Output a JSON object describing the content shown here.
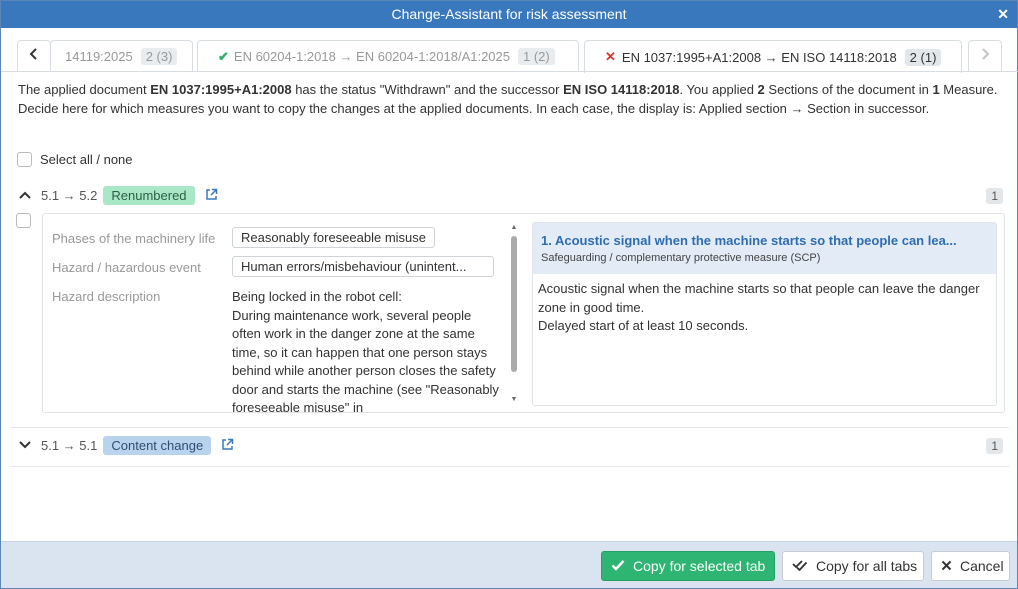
{
  "window": {
    "title": "Change-Assistant for risk assessment",
    "close_glyph": "✕"
  },
  "tabs": {
    "prev_glyph": "‹",
    "next_glyph": "›",
    "items": [
      {
        "label": "14119:2025",
        "count": "2 (3)",
        "status": ""
      },
      {
        "label": "EN 60204-1:2018 → EN 60204-1:2018/A1:2025",
        "count": "1 (2)",
        "status": "ok"
      },
      {
        "label": "EN 1037:1995+A1:2008 → EN ISO 14118:2018",
        "count": "2 (1)",
        "status": "error",
        "active": true
      }
    ],
    "ok_glyph": "✔",
    "error_glyph": "✕"
  },
  "info": {
    "p1": "The applied document ",
    "doc": "EN 1037:1995+A1:2008",
    "p2": " has the status \"Withdrawn\" and the successor ",
    "successor": "EN ISO 14118:2018",
    "p3": ". You applied ",
    "sections": "2",
    "p4": " Sections of the document in ",
    "measures": "1",
    "p5": " Measure. Decide here for which measures you want to copy the changes at the applied documents. In each case, the display is: Applied section → Section in successor."
  },
  "select_all": {
    "label": "Select all / none"
  },
  "sections": [
    {
      "chevron": "^",
      "mapping": "5.1 → 5.2",
      "badge": "Renumbered",
      "count": "1",
      "ext_icon": "↗"
    },
    {
      "chevron": "v",
      "mapping": "5.1 → 5.1",
      "badge": "Content change",
      "count": "1",
      "ext_icon": "↗"
    }
  ],
  "hazard": {
    "phase_label": "Phases of the machinery life",
    "phase_value": "Reasonably foreseeable misuse",
    "hazard_label": "Hazard / hazardous event",
    "hazard_value": "Human errors/misbehaviour (unintent...",
    "desc_label": "Hazard description",
    "desc_lines": [
      "Being locked in the robot cell:",
      "During maintenance work, several people often work in the danger zone at the same time, so it can happen that one person stays behind while another person closes the safety door and starts the machine (see \"Reasonably foreseeable misuse\" in"
    ]
  },
  "measure": {
    "title": "1. Acoustic signal when the machine starts so that people can lea...",
    "subtitle": "Safeguarding / complementary protective measure (SCP)",
    "body_line1": "Acoustic signal when the machine starts so that people can leave the danger zone in good time.",
    "body_line2": "Delayed start of at least 10 seconds."
  },
  "footer": {
    "copy_selected": "Copy for selected tab",
    "copy_all": "Copy for all tabs",
    "cancel": "Cancel"
  },
  "colors": {
    "titlebar": "#3a78bd",
    "primary": "#2eb574",
    "accent": "#2f6db1"
  }
}
